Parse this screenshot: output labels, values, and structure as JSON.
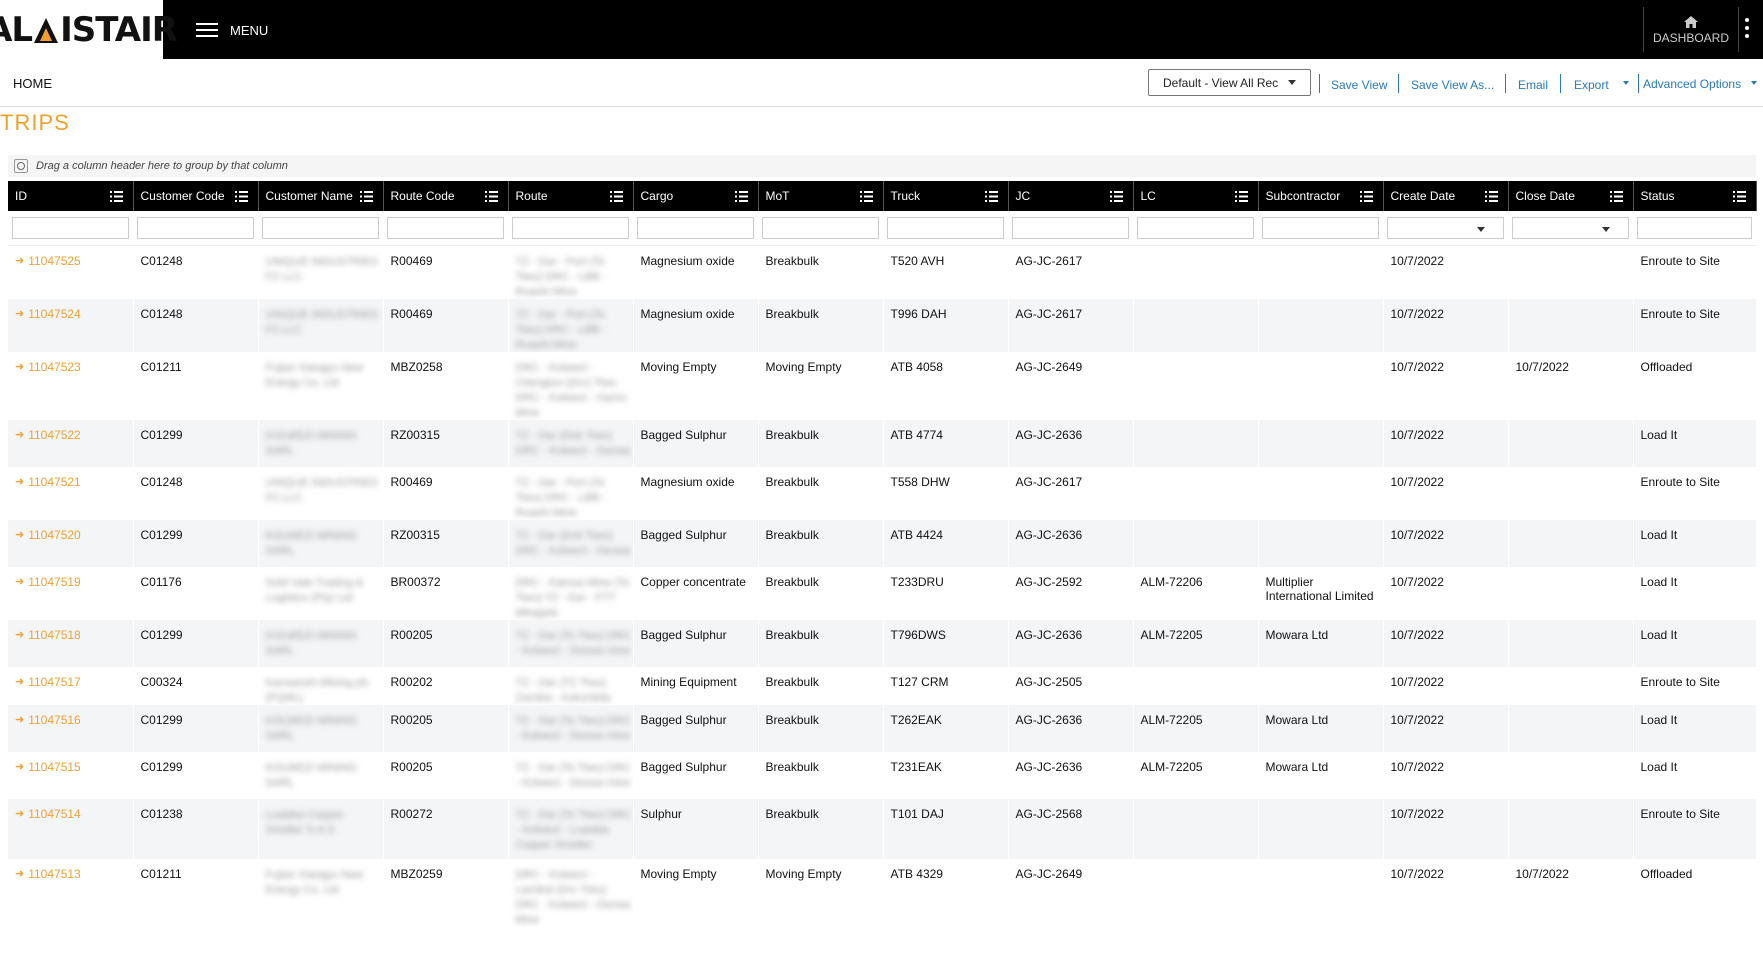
{
  "header": {
    "logo_text_1": "AL",
    "logo_text_2": "ISTAIR",
    "menu_label": "MENU",
    "dashboard_label": "DASHBOARD"
  },
  "breadcrumb": {
    "home": "HOME"
  },
  "toolbar": {
    "view_select": "Default - View All Rec",
    "save_view": "Save View",
    "save_view_as": "Save View As...",
    "email": "Email",
    "export": "Export",
    "advanced_options": "Advanced Options"
  },
  "page": {
    "title": "TRIPS",
    "group_hint": "Drag a column header here to group by that column"
  },
  "grid": {
    "columns": [
      "ID",
      "Customer Code",
      "Customer Name",
      "Route Code",
      "Route",
      "Cargo",
      "MoT",
      "Truck",
      "JC",
      "LC",
      "Subcontractor",
      "Create Date",
      "Close Date",
      "Status"
    ],
    "rows": [
      {
        "id": "11047525",
        "cc": "C01248",
        "cn": "UNIQUE INDUSTRIES FZ LLC",
        "rc": "R00469",
        "rt": "TZ - Dar - Port (To Tiwu) DRC - LBB - Ruashi Mine",
        "cargo": "Magnesium oxide",
        "mot": "Breakbulk",
        "truck": "T520 AVH",
        "jc": "AG-JC-2617",
        "lc": "",
        "sub": "",
        "cd": "10/7/2022",
        "cl": "",
        "st": "Enroute to Site"
      },
      {
        "id": "11047524",
        "cc": "C01248",
        "cn": "UNIQUE INDUSTRIES FZ LLC",
        "rc": "R00469",
        "rt": "TZ - Dar - Port (To Tiwu) DRC - LBB - Ruashi Mine",
        "cargo": "Magnesium oxide",
        "mot": "Breakbulk",
        "truck": "T996 DAH",
        "jc": "AG-JC-2617",
        "lc": "",
        "sub": "",
        "cd": "10/7/2022",
        "cl": "",
        "st": "Enroute to Site"
      },
      {
        "id": "11047523",
        "cc": "C01211",
        "cn": "Fujian Xiangyu New Energy Co. Ltd",
        "rc": "MBZ0258",
        "rt": "DRC - Kolwezi - Chengtun (Drc) Tiwu DRC - Kolwezi - Hanru Mine",
        "cargo": "Moving Empty",
        "mot": "Moving Empty",
        "truck": "ATB 4058",
        "jc": "AG-JC-2649",
        "lc": "",
        "sub": "",
        "cd": "10/7/2022",
        "cl": "10/7/2022",
        "st": "Offloaded"
      },
      {
        "id": "11047522",
        "cc": "C01299",
        "cn": "KOLWEZI MINING SARL",
        "rc": "RZ00315",
        "rt": "TZ - Dar (Dnk Tiwu) DRC - Kolwezi - Dezwa",
        "cargo": "Bagged Sulphur",
        "mot": "Breakbulk",
        "truck": "ATB 4774",
        "jc": "AG-JC-2636",
        "lc": "",
        "sub": "",
        "cd": "10/7/2022",
        "cl": "",
        "st": "Load It"
      },
      {
        "id": "11047521",
        "cc": "C01248",
        "cn": "UNIQUE INDUSTRIES FZ LLC",
        "rc": "R00469",
        "rt": "TZ - Dar - Port (To Tiwu) DRC - LBB - Ruashi Mine",
        "cargo": "Magnesium oxide",
        "mot": "Breakbulk",
        "truck": "T558 DHW",
        "jc": "AG-JC-2617",
        "lc": "",
        "sub": "",
        "cd": "10/7/2022",
        "cl": "",
        "st": "Enroute to Site"
      },
      {
        "id": "11047520",
        "cc": "C01299",
        "cn": "KOLWEZI MINING SARL",
        "rc": "RZ00315",
        "rt": "TZ - Dar (Dnk Tiwu) DRC - Kolwezi - Dezwa",
        "cargo": "Bagged Sulphur",
        "mot": "Breakbulk",
        "truck": "ATB 4424",
        "jc": "AG-JC-2636",
        "lc": "",
        "sub": "",
        "cd": "10/7/2022",
        "cl": "",
        "st": "Load It"
      },
      {
        "id": "11047519",
        "cc": "C01176",
        "cn": "Gold Vale Trading & Logistics (Pty) Ltd",
        "rc": "BR00372",
        "rt": "DRC - Kamoa Mine (To Tiwu) TZ - Dar - FTT Mbagala",
        "cargo": "Copper concentrate",
        "mot": "Breakbulk",
        "truck": "T233DRU",
        "jc": "AG-JC-2592",
        "lc": "ALM-72206",
        "sub": "Multiplier International Limited",
        "cd": "10/7/2022",
        "cl": "",
        "st": "Load It"
      },
      {
        "id": "11047518",
        "cc": "C01299",
        "cn": "KOLWEZI MINING SARL",
        "rc": "R00205",
        "rt": "TZ - Dar (To Tiwu) DRC - Kolwezi - Dezwa mine",
        "cargo": "Bagged Sulphur",
        "mot": "Breakbulk",
        "truck": "T796DWS",
        "jc": "AG-JC-2636",
        "lc": "ALM-72205",
        "sub": "Mowara Ltd",
        "cd": "10/7/2022",
        "cl": "",
        "st": "Load It"
      },
      {
        "id": "11047517",
        "cc": "C00324",
        "cn": "Kansanshi Mining plc (FQML)",
        "rc": "R00202",
        "rt": "TZ - Dar (TZ Tiwu) Zambia - Kalumbila",
        "cargo": "Mining Equipment",
        "mot": "Breakbulk",
        "truck": "T127 CRM",
        "jc": "AG-JC-2505",
        "lc": "",
        "sub": "",
        "cd": "10/7/2022",
        "cl": "",
        "st": "Enroute to Site"
      },
      {
        "id": "11047516",
        "cc": "C01299",
        "cn": "KOLWEZI MINING SARL",
        "rc": "R00205",
        "rt": "TZ - Dar (To Tiwu) DRC - Kolwezi - Dezwa mine",
        "cargo": "Bagged Sulphur",
        "mot": "Breakbulk",
        "truck": "T262EAK",
        "jc": "AG-JC-2636",
        "lc": "ALM-72205",
        "sub": "Mowara Ltd",
        "cd": "10/7/2022",
        "cl": "",
        "st": "Load It"
      },
      {
        "id": "11047515",
        "cc": "C01299",
        "cn": "KOLWEZI MINING SARL",
        "rc": "R00205",
        "rt": "TZ - Dar (To Tiwu) DRC - Kolwezi - Dezwa mine",
        "cargo": "Bagged Sulphur",
        "mot": "Breakbulk",
        "truck": "T231EAK",
        "jc": "AG-JC-2636",
        "lc": "ALM-72205",
        "sub": "Mowara Ltd",
        "cd": "10/7/2022",
        "cl": "",
        "st": "Load It"
      },
      {
        "id": "11047514",
        "cc": "C01238",
        "cn": "Lualaba Copper Smelter S.A.S",
        "rc": "R00272",
        "rt": "TZ - Dar (To Tiwu) DRC - Kolwezi - Lualaba Copper Smelter",
        "cargo": "Sulphur",
        "mot": "Breakbulk",
        "truck": "T101 DAJ",
        "jc": "AG-JC-2568",
        "lc": "",
        "sub": "",
        "cd": "10/7/2022",
        "cl": "",
        "st": "Enroute to Site"
      },
      {
        "id": "11047513",
        "cc": "C01211",
        "cn": "Fujian Xiangyu New Energy Co. Ltd",
        "rc": "MBZ0259",
        "rt": "DRC - Kolwezi - Lamikal (Drc Tiwu) DRC - Kolwezi - Dezwa Mine",
        "cargo": "Moving Empty",
        "mot": "Moving Empty",
        "truck": "ATB 4329",
        "jc": "AG-JC-2649",
        "lc": "",
        "sub": "",
        "cd": "10/7/2022",
        "cl": "10/7/2022",
        "st": "Offloaded"
      }
    ]
  }
}
